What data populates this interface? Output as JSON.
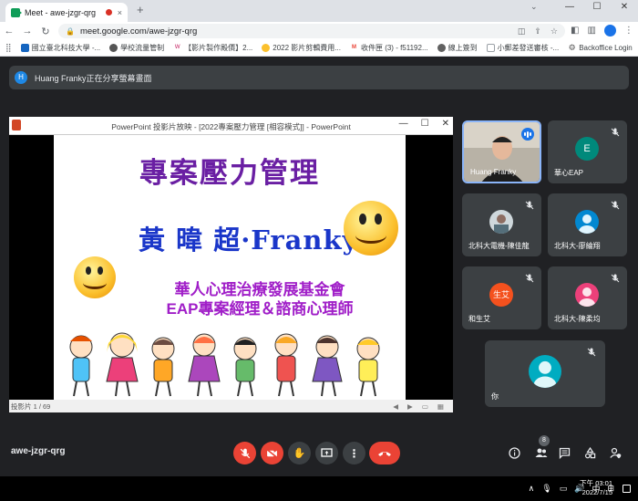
{
  "browser": {
    "tab_title": "Meet - awe-jzgr-qrg",
    "tab_close": "×",
    "new_tab": "+",
    "url": "meet.google.com/awe-jzgr-qrg",
    "tab_dropdown": "⌄",
    "window_controls": [
      "—",
      "☐",
      "✕"
    ],
    "nav": {
      "back": "←",
      "forward": "→",
      "reload": "↻"
    },
    "bookmarks": [
      {
        "label": "國立臺北科技大學 -..."
      },
      {
        "label": "學校流量管制"
      },
      {
        "label": "【影片製作殿價】2..."
      },
      {
        "label": "2022 影片剪輯費用..."
      },
      {
        "label": "收件匣 (3) - f51192..."
      },
      {
        "label": "線上簽到"
      },
      {
        "label": "小郵差發送審核 -..."
      },
      {
        "label": "Backoffice Login"
      }
    ]
  },
  "meet": {
    "share_banner": {
      "avatar_letter": "H",
      "text": "Huang Franky正在分享螢幕畫面"
    },
    "presentation": {
      "window_title": "PowerPoint 投影片放映 - [2022專案壓力管理 [相容模式]] - PowerPoint",
      "window_controls": [
        "—",
        "☐",
        "✕"
      ],
      "slide": {
        "title": "專案壓力管理",
        "name": "黃 暐 超·Franky",
        "org": "華人心理治療發展基金會",
        "role": "EAP專案經理＆諮商心理師"
      },
      "status": "投影片 1 / 69"
    },
    "participants": [
      {
        "name": "Huang Franky",
        "type": "video",
        "speaking": true
      },
      {
        "name": "華心EAP",
        "initial": "E",
        "color": "#00897b",
        "muted": true
      },
      {
        "name": "北科大電機-陳佳龍",
        "type": "photo",
        "muted": true
      },
      {
        "name": "北科大-廖綸翔",
        "type": "avatar",
        "color": "#0288d1",
        "muted": true
      },
      {
        "name": "和生艾",
        "initial": "生艾",
        "color": "#f4511e",
        "muted": true
      },
      {
        "name": "北科大-陳柔均",
        "type": "avatar",
        "color": "#ec407a",
        "muted": true
      },
      {
        "name": "你",
        "type": "avatar",
        "color": "#00acc1",
        "muted": true
      }
    ],
    "meeting_code": "awe-jzgr-qrg",
    "participant_count": "8"
  },
  "taskbar": {
    "time": "下午 03:01",
    "date": "2022/7/15"
  }
}
